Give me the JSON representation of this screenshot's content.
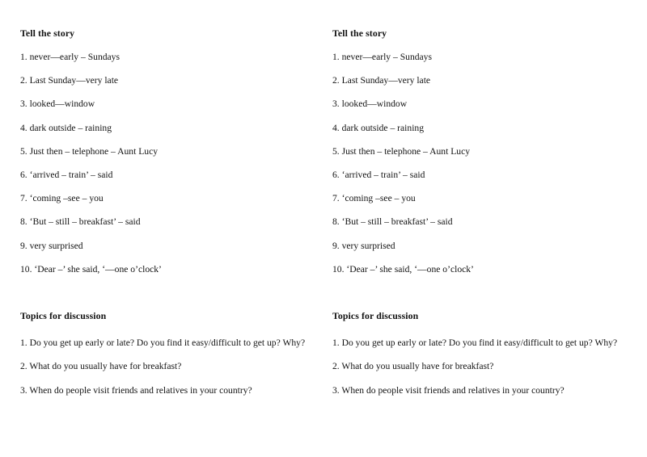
{
  "document": {
    "background_color": "#ffffff",
    "text_color": "#131313",
    "layout": "two-column-duplicate"
  },
  "columns": [
    {
      "name": "left-column",
      "sections": [
        {
          "name": "tell-the-story",
          "heading": "Tell the story",
          "items": [
            "1. never—early – Sundays",
            "2. Last Sunday—very late",
            "3. looked—window",
            "4. dark outside – raining",
            "5. Just then – telephone – Aunt Lucy",
            "6. ‘arrived – train’ – said",
            "7. ‘coming –see – you",
            "8. ‘But – still – breakfast’ – said",
            "9. very surprised",
            "10. ‘Dear –’ she said, ‘—one o’clock’"
          ]
        },
        {
          "name": "topics-for-discussion",
          "heading": "Topics for discussion",
          "items": [
            "1. Do you get up early or late? Do you find it easy/difficult to get up? Why?",
            "2. What do you usually have for breakfast?",
            "3. When do people visit friends and relatives in your country?"
          ]
        }
      ]
    },
    {
      "name": "right-column",
      "sections": [
        {
          "name": "tell-the-story",
          "heading": "Tell the story",
          "items": [
            "1. never—early – Sundays",
            "2. Last Sunday—very late",
            "3. looked—window",
            "4. dark outside – raining",
            "5. Just then – telephone – Aunt Lucy",
            "6. ‘arrived – train’ – said",
            "7. ‘coming –see – you",
            "8. ‘But – still – breakfast’ – said",
            "9. very surprised",
            "10. ‘Dear –’ she said, ‘—one o’clock’"
          ]
        },
        {
          "name": "topics-for-discussion",
          "heading": "Topics for discussion",
          "items": [
            "1. Do you get up early or late? Do you find it easy/difficult to get up? Why?",
            "2. What do you usually have for breakfast?",
            "3. When do people visit friends and relatives in your country?"
          ]
        }
      ]
    }
  ]
}
